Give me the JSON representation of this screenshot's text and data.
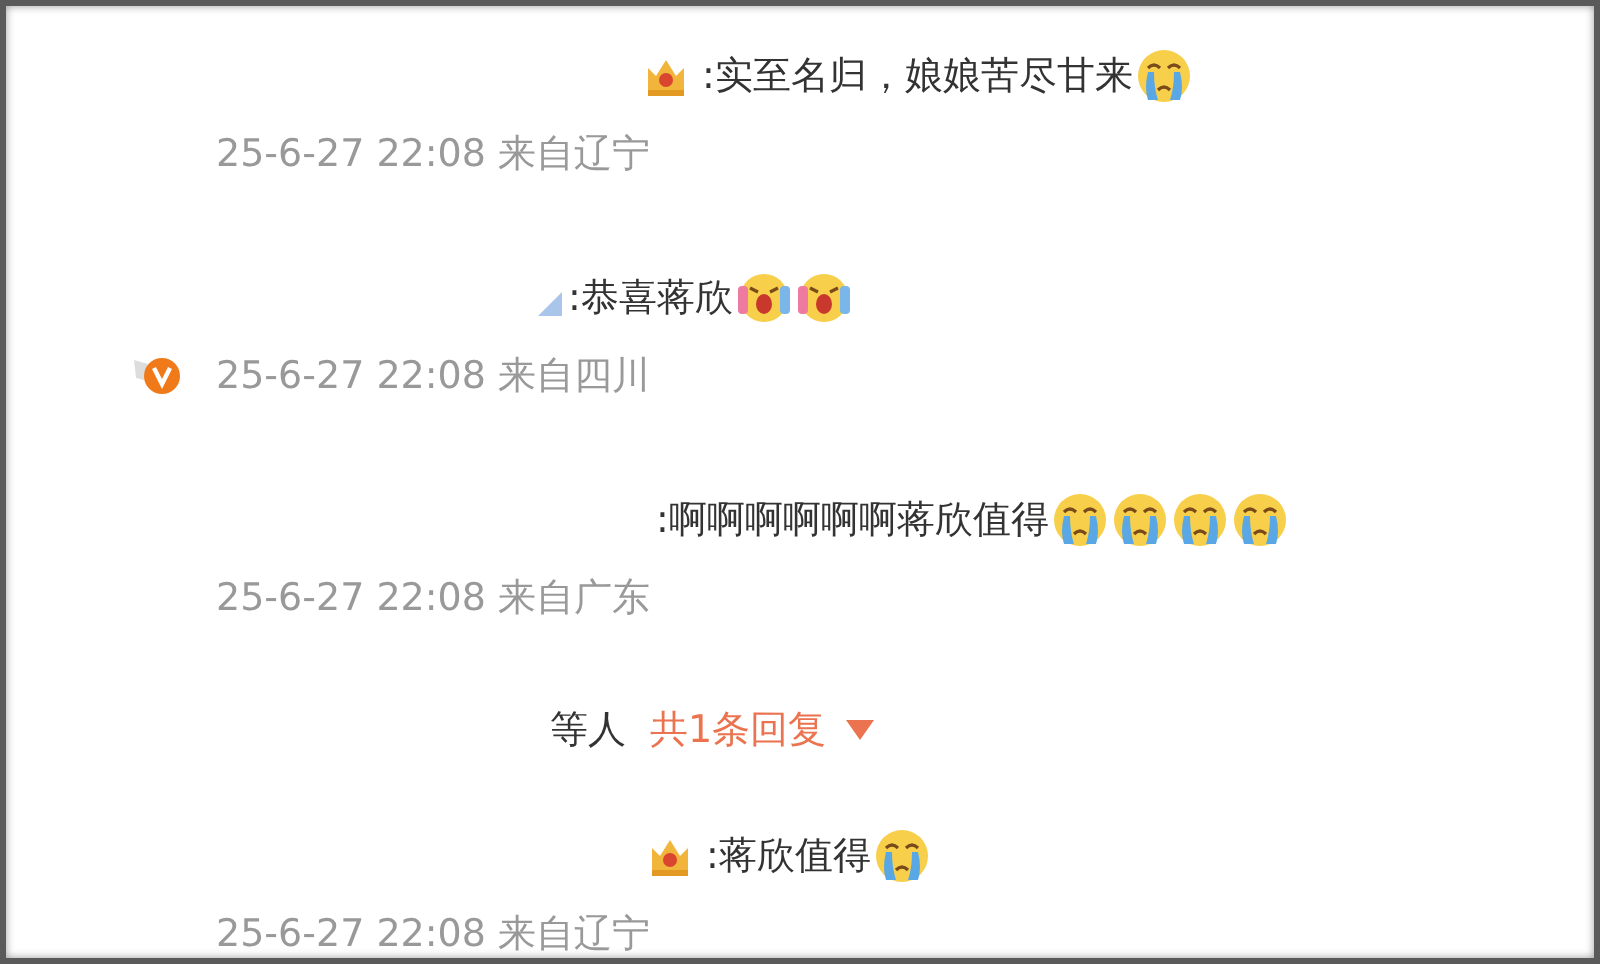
{
  "items": [
    {
      "kind": "comment",
      "badge": {
        "kind": "crown"
      },
      "text": ":实至名归，娘娘苦尽甘来",
      "emojis": [
        {
          "kind": "crying"
        }
      ],
      "verified": false,
      "meta": "25-6-27 22:08 来自辽宁"
    },
    {
      "kind": "comment",
      "badge": {
        "kind": "fragment"
      },
      "text": ":恭喜蒋欣",
      "emojis": [
        {
          "kind": "shouting"
        },
        {
          "kind": "shouting"
        }
      ],
      "verified": true,
      "meta": "25-6-27 22:08 来自四川"
    },
    {
      "kind": "comment",
      "text": ":啊啊啊啊啊啊蒋欣值得",
      "emojis": [
        {
          "kind": "crying"
        },
        {
          "kind": "crying"
        },
        {
          "kind": "crying"
        },
        {
          "kind": "crying"
        }
      ],
      "verified": false,
      "meta": "25-6-27 22:08 来自广东"
    },
    {
      "kind": "replies",
      "prefix": "等人",
      "link": "共1条回复",
      "expanded": false
    },
    {
      "kind": "comment",
      "badge": {
        "kind": "crown"
      },
      "text": ":蒋欣值得",
      "emojis": [
        {
          "kind": "crying"
        }
      ],
      "verified": false,
      "meta": "25-6-27 22:08 来自辽宁"
    }
  ]
}
